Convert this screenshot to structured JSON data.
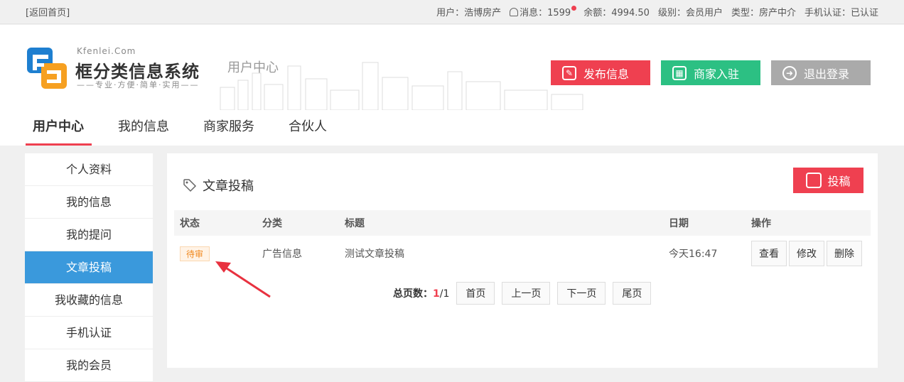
{
  "topbar": {
    "back_label": "[返回首页]",
    "user": "用户：浩博房产",
    "messages_label": "消息：",
    "messages_count": "1599",
    "balance": "余额：4994.50",
    "level": "级别：会员用户",
    "type": "类型：房产中介",
    "phone_verified": "手机认证：已认证"
  },
  "header": {
    "logo_en": "Kfenlei.Com",
    "logo_cn": "框分类信息系统",
    "slogan": "——专业·方便·简单·实用——",
    "subtitle": "用户中心",
    "buttons": {
      "publish": "发布信息",
      "merchant": "商家入驻",
      "logout": "退出登录"
    },
    "colors": {
      "red": "#ef4050",
      "green": "#2cc083",
      "gray": "#aaaaaa"
    }
  },
  "nav": {
    "items": [
      {
        "label": "用户中心"
      },
      {
        "label": "我的信息"
      },
      {
        "label": "商家服务"
      },
      {
        "label": "合伙人"
      }
    ]
  },
  "sidebar": {
    "items": [
      {
        "label": "个人资料"
      },
      {
        "label": "我的信息"
      },
      {
        "label": "我的提问"
      },
      {
        "label": "文章投稿"
      },
      {
        "label": "我收藏的信息"
      },
      {
        "label": "手机认证"
      },
      {
        "label": "我的会员"
      }
    ],
    "active_color": "#3a99dc"
  },
  "main": {
    "title": "文章投稿",
    "post_button": "投稿",
    "columns": [
      "状态",
      "分类",
      "标题",
      "日期",
      "操作"
    ],
    "rows": [
      {
        "status": "待审",
        "category": "广告信息",
        "title": "测试文章投稿",
        "date": "今天16:47",
        "actions": [
          "查看",
          "修改",
          "删除"
        ]
      }
    ],
    "pager": {
      "label": "总页数：",
      "current": "1",
      "total": "/1",
      "first": "首页",
      "prev": "上一页",
      "next": "下一页",
      "last": "尾页"
    }
  }
}
